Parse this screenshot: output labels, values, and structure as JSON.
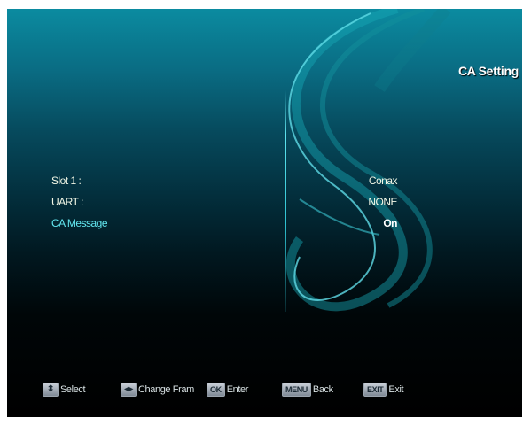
{
  "screen": {
    "title": "CA Setting"
  },
  "settings": [
    {
      "label": "Slot 1 :",
      "value": "Conax",
      "highlighted": false
    },
    {
      "label": "UART :",
      "value": "NONE",
      "highlighted": false
    },
    {
      "label": "CA Message",
      "value": "On",
      "highlighted": true
    }
  ],
  "footer": {
    "select": {
      "key": "updown-arrow-icon",
      "label": "Select"
    },
    "change": {
      "key": "leftright-arrow-icon",
      "label": "Change Fram"
    },
    "enter": {
      "key": "OK",
      "label": "Enter"
    },
    "back": {
      "key": "MENU",
      "label": "Back"
    },
    "exit": {
      "key": "EXIT",
      "label": "Exit"
    }
  },
  "colors": {
    "accent": "#62e6ef",
    "text": "#f2f7e6",
    "background_top": "#0b8ba0",
    "background_bottom": "#000000"
  }
}
